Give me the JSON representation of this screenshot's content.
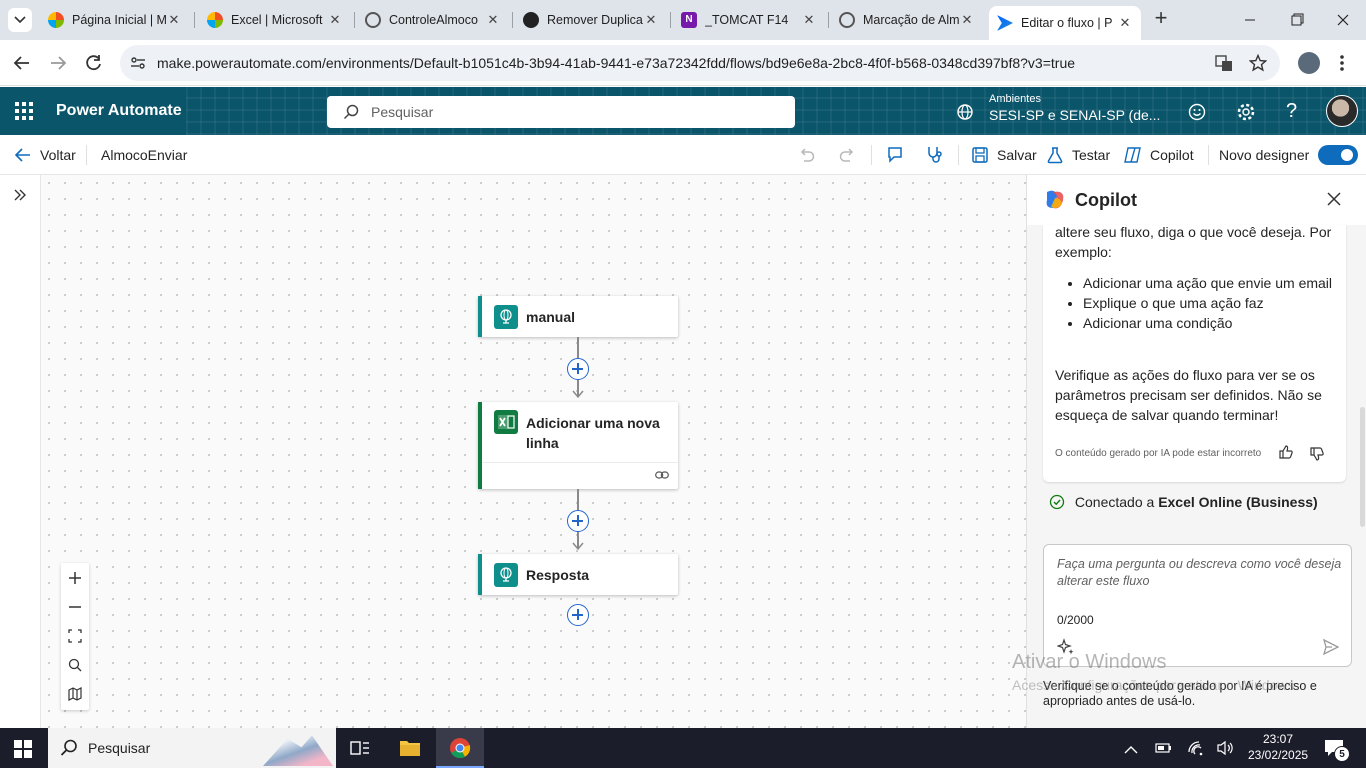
{
  "browser": {
    "tabs": [
      {
        "title": "Página Inicial | M",
        "active": false
      },
      {
        "title": "Excel | Microsoft",
        "active": false
      },
      {
        "title": "ControleAlmoco",
        "active": false
      },
      {
        "title": "Remover Duplica",
        "active": false
      },
      {
        "title": "_TOMCAT F14",
        "active": false
      },
      {
        "title": "Marcação de Alm",
        "active": false
      },
      {
        "title": "Editar o fluxo | P",
        "active": true
      }
    ],
    "url": "make.powerautomate.com/environments/Default-b1051c4b-3b94-41ab-9441-e73a72342fdd/flows/bd9e6e8a-2bc8-4f0f-b568-0348cd397bf8?v3=true"
  },
  "header": {
    "app_name": "Power Automate",
    "search_placeholder": "Pesquisar",
    "env_label": "Ambientes",
    "env_name": "SESI-SP e SENAI-SP (de..."
  },
  "commandbar": {
    "back_label": "Voltar",
    "flow_name": "AlmocoEnviar",
    "save_label": "Salvar",
    "test_label": "Testar",
    "copilot_label": "Copilot",
    "new_designer_label": "Novo designer",
    "new_designer_on": true
  },
  "flow": {
    "nodes": [
      {
        "label": "manual",
        "color": "#0f8f8c"
      },
      {
        "label": "Adicionar uma nova linha",
        "color": "#107c41"
      },
      {
        "label": "Resposta",
        "color": "#0f8f8c"
      }
    ]
  },
  "copilot": {
    "title": "Copilot",
    "intro": "altere seu fluxo, diga o que você deseja. Por exemplo:",
    "suggestions": [
      "Adicionar uma ação que envie um email",
      "Explique o que uma ação faz",
      "Adicionar uma condição"
    ],
    "note": "Verifique as ações do fluxo para ver se os parâmetros precisam ser definidos. Não se esqueça de salvar quando terminar!",
    "disclaimer": "O conteúdo gerado por IA pode estar incorreto",
    "connected_prefix": "Conectado a ",
    "connected_service": "Excel Online (Business)",
    "input_placeholder": "Faça uma pergunta ou descreva como você deseja alterar este fluxo",
    "char_count": "0/2000",
    "footer": "Verifique se o conteúdo gerado por IA é preciso e apropriado antes de usá-lo."
  },
  "watermark": {
    "line1": "Ativar o Windows",
    "line2": "Acesse Configurações para ativar o Windows."
  },
  "taskbar": {
    "search_label": "Pesquisar",
    "time": "23:07",
    "date": "23/02/2025",
    "notification_count": "5"
  },
  "colors": {
    "accent": "#0f6cbd",
    "header_bg": "#0b556a",
    "taskbar_bg": "#1c1d2a"
  }
}
